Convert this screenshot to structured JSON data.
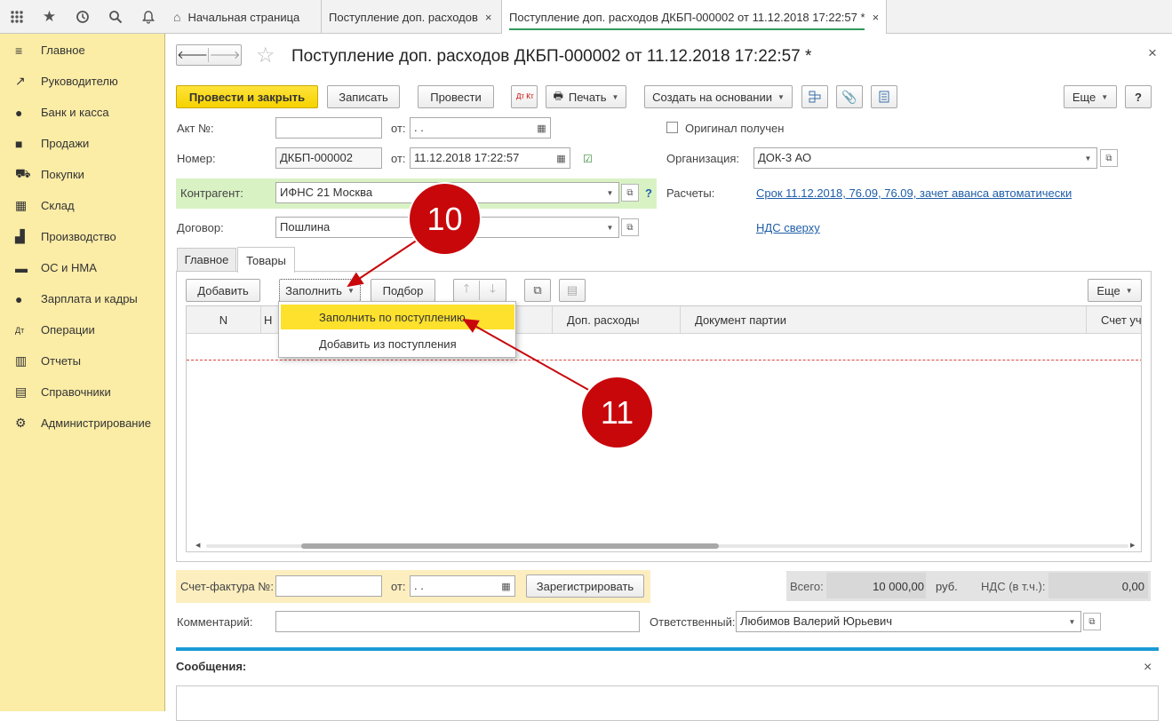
{
  "topbar": {
    "icons": [
      "apps-grid-icon",
      "star-icon",
      "history-icon",
      "search-icon",
      "bell-icon"
    ],
    "home_tab": "Начальная страница",
    "tab2": "Поступление доп. расходов",
    "tab3": "Поступление доп. расходов ДКБП-000002 от 11.12.2018 17:22:57 *",
    "close": "×"
  },
  "sidebar": {
    "items": [
      {
        "label": "Главное",
        "icon": "≡"
      },
      {
        "label": "Руководителю",
        "icon": "↗"
      },
      {
        "label": "Банк и касса",
        "icon": "●"
      },
      {
        "label": "Продажи",
        "icon": "■"
      },
      {
        "label": "Покупки",
        "icon": "⛟"
      },
      {
        "label": "Склад",
        "icon": "▦"
      },
      {
        "label": "Производство",
        "icon": "▟"
      },
      {
        "label": "ОС и НМА",
        "icon": "▬"
      },
      {
        "label": "Зарплата и кадры",
        "icon": "●"
      },
      {
        "label": "Операции",
        "icon": "Дт"
      },
      {
        "label": "Отчеты",
        "icon": "▥"
      },
      {
        "label": "Справочники",
        "icon": "▤"
      },
      {
        "label": "Администрирование",
        "icon": "⚙"
      }
    ]
  },
  "doc": {
    "title": "Поступление доп. расходов ДКБП-000002 от 11.12.2018 17:22:57 *",
    "nav_back": "🡐",
    "nav_fwd": "🡒",
    "star": "☆",
    "close": "×"
  },
  "toolbar": {
    "post_close": "Провести и закрыть",
    "save": "Записать",
    "post": "Провести",
    "dtkt": "Дт Кт",
    "print": "Печать",
    "create_based": "Создать на основании",
    "more": "Еще",
    "help": "?"
  },
  "form": {
    "act_label": "Акт №:",
    "act_value": "",
    "from1": "от:",
    "act_date": " .  .",
    "original_label": "Оригинал получен",
    "number_label": "Номер:",
    "number_value": "ДКБП-000002",
    "from2": "от:",
    "number_date": "11.12.2018 17:22:57",
    "org_label": "Организация:",
    "org_value": "ДОК-3 АО",
    "contractor_label": "Контрагент:",
    "contractor_value": "ИФНС 21 Москва",
    "question": "?",
    "settlements_label": "Расчеты:",
    "settlements_link": "Срок 11.12.2018, 76.09, 76.09, зачет аванса автоматически",
    "contract_label": "Договор:",
    "contract_value": "Пошлина",
    "vat_link": "НДС сверху"
  },
  "tabs": {
    "main": "Главное",
    "goods": "Товары"
  },
  "goods_toolbar": {
    "add": "Добавить",
    "fill": "Заполнить",
    "pick": "Подбор",
    "more": "Еще"
  },
  "table": {
    "headers": [
      "N",
      "Н",
      "Доп. расходы",
      "Документ партии",
      "Счет уч"
    ]
  },
  "dropdown": {
    "items": [
      "Заполнить по поступлению",
      "Добавить из поступления"
    ]
  },
  "invoice": {
    "label": "Счет-фактура №:",
    "value": "",
    "from": "от:",
    "date": " .  .",
    "register": "Зарегистрировать"
  },
  "totals": {
    "total_label": "Всего:",
    "total_value": "10 000,00",
    "currency": "руб.",
    "vat_label": "НДС (в т.ч.):",
    "vat_value": "0,00"
  },
  "footer": {
    "comment_label": "Комментарий:",
    "comment_value": "",
    "responsible_label": "Ответственный:",
    "responsible_value": "Любимов Валерий Юрьевич"
  },
  "messages": {
    "title": "Сообщения:",
    "close": "×"
  },
  "callouts": {
    "c10": "10",
    "c11": "11"
  },
  "colors": {
    "sidebar_bg": "#fbeca6",
    "accent_yellow": "#f6d200",
    "callout_red": "#c8070b",
    "link_blue": "#1f5ea8",
    "contractor_green": "#d9f2c4"
  }
}
